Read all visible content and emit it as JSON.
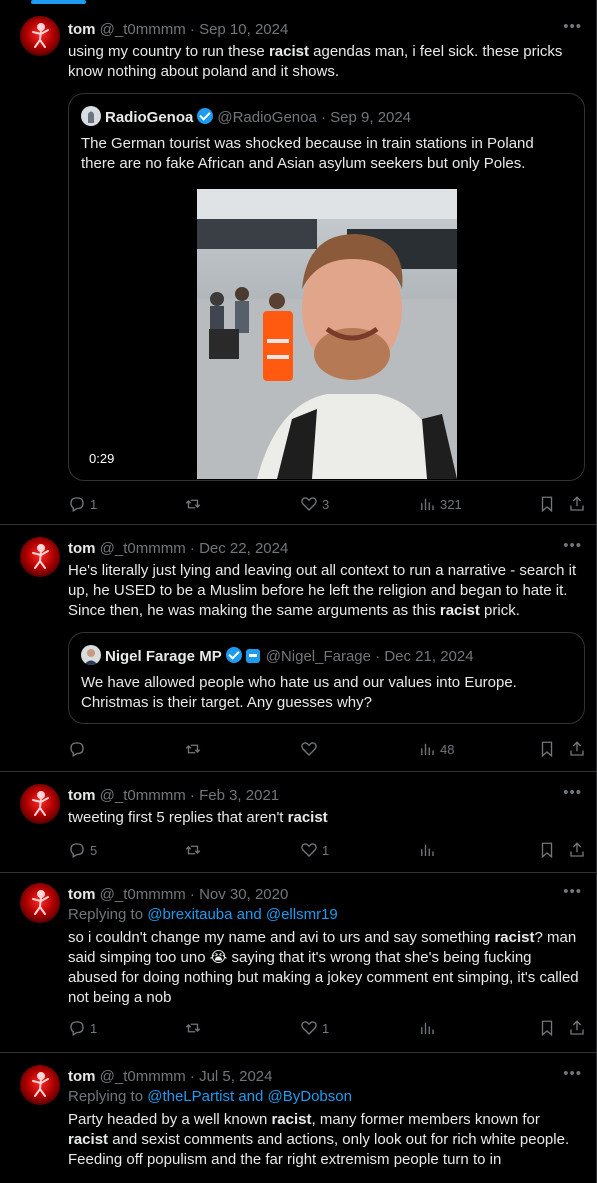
{
  "tweets": [
    {
      "name": "tom",
      "handle": "@_t0mmmm",
      "date": "Sep 10, 2024",
      "text_parts": [
        "using my country to run these ",
        "racist",
        " agendas man, i feel sick. these pricks know nothing about poland and it shows."
      ],
      "quote": {
        "name": "RadioGenoa",
        "handle": "@RadioGenoa",
        "date": "Sep 9, 2024",
        "text": "The German tourist was shocked because in train stations in Poland there are no fake African and Asian asylum seekers but only Poles.",
        "video_duration": "0:29"
      },
      "actions": {
        "replies": "1",
        "reposts": "",
        "likes": "3",
        "views": "321"
      }
    },
    {
      "name": "tom",
      "handle": "@_t0mmmm",
      "date": "Dec 22, 2024",
      "text_parts": [
        "He's literally just lying and leaving out all context to run a narrative - search it up, he USED to be a Muslim before he left the religion and began to hate it. Since then, he was making the same arguments as this ",
        "racist",
        " prick."
      ],
      "quote": {
        "name": "Nigel Farage MP",
        "handle": "@Nigel_Farage",
        "date": "Dec 21, 2024",
        "text": "We have allowed people who hate us and our values into Europe. Christmas is their target. Any guesses why?"
      },
      "actions": {
        "replies": "",
        "reposts": "",
        "likes": "",
        "views": "48"
      }
    },
    {
      "name": "tom",
      "handle": "@_t0mmmm",
      "date": "Feb 3, 2021",
      "text_parts": [
        "tweeting first 5 replies that aren't ",
        "racist",
        ""
      ],
      "actions": {
        "replies": "5",
        "reposts": "",
        "likes": "1",
        "views": ""
      }
    },
    {
      "name": "tom",
      "handle": "@_t0mmmm",
      "date": "Nov 30, 2020",
      "replying_prefix": "Replying to ",
      "replying_to": "@brexitauba and @ellsmr19",
      "text_parts": [
        "so i couldn't change my name and avi to urs and say something ",
        "racist",
        "? man said simping too uno 😭 saying that it's wrong that she's being fucking abused for doing  nothing but making a jokey comment ent simping, it's called not being a nob"
      ],
      "actions": {
        "replies": "1",
        "reposts": "",
        "likes": "1",
        "views": ""
      }
    },
    {
      "name": "tom",
      "handle": "@_t0mmmm",
      "date": "Jul 5, 2024",
      "replying_prefix": "Replying to ",
      "replying_to": "@theLPartist and @ByDobson",
      "text_parts": [
        "Party headed by a well known ",
        "racist",
        ", many former members known for ",
        "racist",
        " and sexist comments and actions, only look out for rich white people. Feeding off populism and the far right extremism people turn to in"
      ]
    }
  ],
  "icons": [
    "reply-icon",
    "repost-icon",
    "like-icon",
    "views-icon",
    "bookmark-icon",
    "share-icon",
    "more-icon",
    "verified-badge-icon"
  ],
  "colors": {
    "background": "#000000",
    "text": "#e7e9ea",
    "muted": "#71767b",
    "accent": "#1d9bf0",
    "border": "#2f3336"
  }
}
